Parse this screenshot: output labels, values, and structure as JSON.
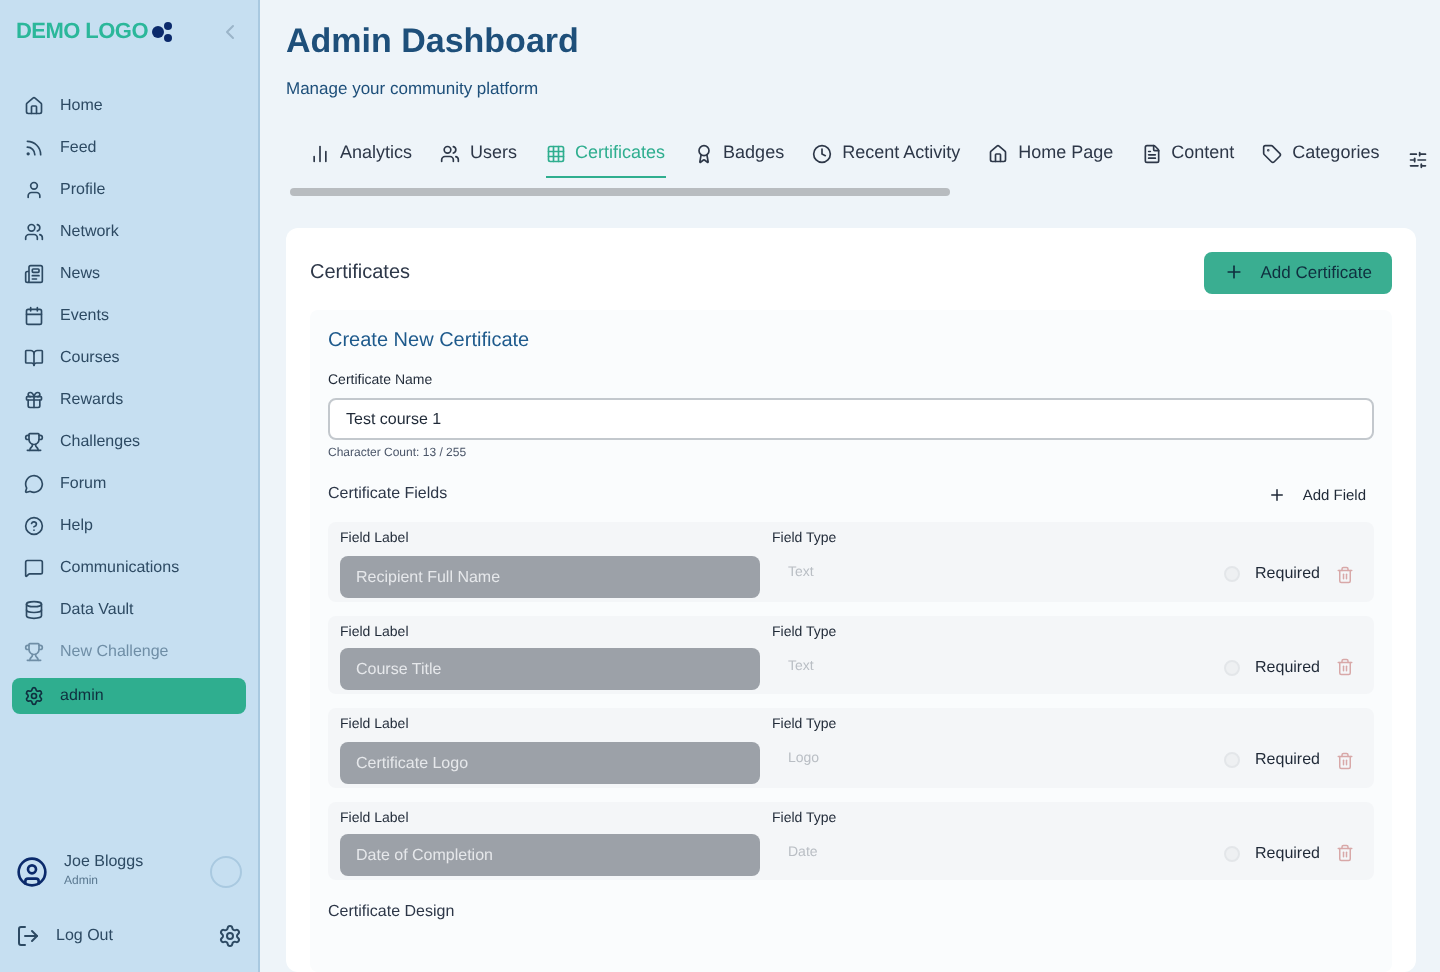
{
  "sidebar": {
    "logo": "DEMO LOGO",
    "items": [
      {
        "label": "Home",
        "selected": false,
        "disabled": false
      },
      {
        "label": "Feed",
        "selected": false,
        "disabled": false
      },
      {
        "label": "Profile",
        "selected": false,
        "disabled": false
      },
      {
        "label": "Network",
        "selected": false,
        "disabled": false
      },
      {
        "label": "News",
        "selected": false,
        "disabled": false
      },
      {
        "label": "Events",
        "selected": false,
        "disabled": false
      },
      {
        "label": "Courses",
        "selected": false,
        "disabled": false
      },
      {
        "label": "Rewards",
        "selected": false,
        "disabled": false
      },
      {
        "label": "Challenges",
        "selected": false,
        "disabled": false
      },
      {
        "label": "Forum",
        "selected": false,
        "disabled": false
      },
      {
        "label": "Help",
        "selected": false,
        "disabled": false
      },
      {
        "label": "Communications",
        "selected": false,
        "disabled": false
      },
      {
        "label": "Data Vault",
        "selected": false,
        "disabled": false
      },
      {
        "label": "New Challenge",
        "selected": false,
        "disabled": true
      },
      {
        "label": "admin",
        "selected": true,
        "disabled": false
      }
    ],
    "user": {
      "name": "Joe Bloggs",
      "role": "Admin"
    },
    "logout": "Log Out"
  },
  "header": {
    "title": "Admin Dashboard",
    "subtitle": "Manage your community platform"
  },
  "tabs": [
    {
      "label": "Analytics",
      "selected": false
    },
    {
      "label": "Users",
      "selected": false
    },
    {
      "label": "Certificates",
      "selected": true
    },
    {
      "label": "Badges",
      "selected": false
    },
    {
      "label": "Recent Activity",
      "selected": false
    },
    {
      "label": "Home Page",
      "selected": false
    },
    {
      "label": "Content",
      "selected": false
    },
    {
      "label": "Categories",
      "selected": false
    }
  ],
  "panel": {
    "title": "Certificates",
    "add_button": "Add Certificate",
    "form": {
      "title": "Create New Certificate",
      "name_label": "Certificate Name",
      "name_value": "Test course 1",
      "char_count": "Character Count: 13 / 255",
      "fields_title": "Certificate Fields",
      "add_field": "Add Field",
      "fields": [
        {
          "label_caption": "Field Label",
          "label_value": "Recipient Full Name",
          "type_caption": "Field Type",
          "type_value": "Text",
          "required_label": "Required",
          "required": false
        },
        {
          "label_caption": "Field Label",
          "label_value": "Course Title",
          "type_caption": "Field Type",
          "type_value": "Text",
          "required_label": "Required",
          "required": false
        },
        {
          "label_caption": "Field Label",
          "label_value": "Certificate Logo",
          "type_caption": "Field Type",
          "type_value": "Logo",
          "required_label": "Required",
          "required": false
        },
        {
          "label_caption": "Field Label",
          "label_value": "Date of Completion",
          "type_caption": "Field Type",
          "type_value": "Date",
          "required_label": "Required",
          "required": false
        }
      ],
      "design_title": "Certificate Design"
    }
  }
}
